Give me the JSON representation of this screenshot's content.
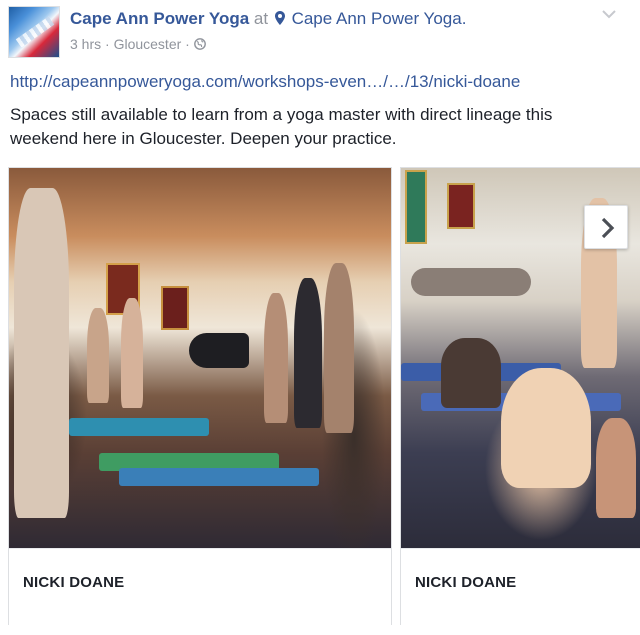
{
  "post": {
    "page_name": "Cape Ann Power Yoga",
    "at_word": "at",
    "location": "Cape Ann Power Yoga.",
    "time": "3 hrs",
    "place": "Gloucester",
    "separator": "·",
    "link_url": "http://capeannpoweryoga.com/workshops-even…/…/13/nicki-doane",
    "text": "Spaces still available to learn from a yoga master with direct lineage this weekend here in Gloucester. Deepen your practice."
  },
  "carousel": {
    "cards": [
      {
        "label": "NICKI DOANE"
      },
      {
        "label": "NICKI DOANE"
      }
    ]
  },
  "icons": {
    "location": "map-pin-icon",
    "audience": "globe-icon",
    "menu": "chevron-down-icon",
    "next": "chevron-right-icon"
  },
  "colors": {
    "link": "#365899",
    "text": "#1d2129",
    "muted": "#90949c"
  }
}
